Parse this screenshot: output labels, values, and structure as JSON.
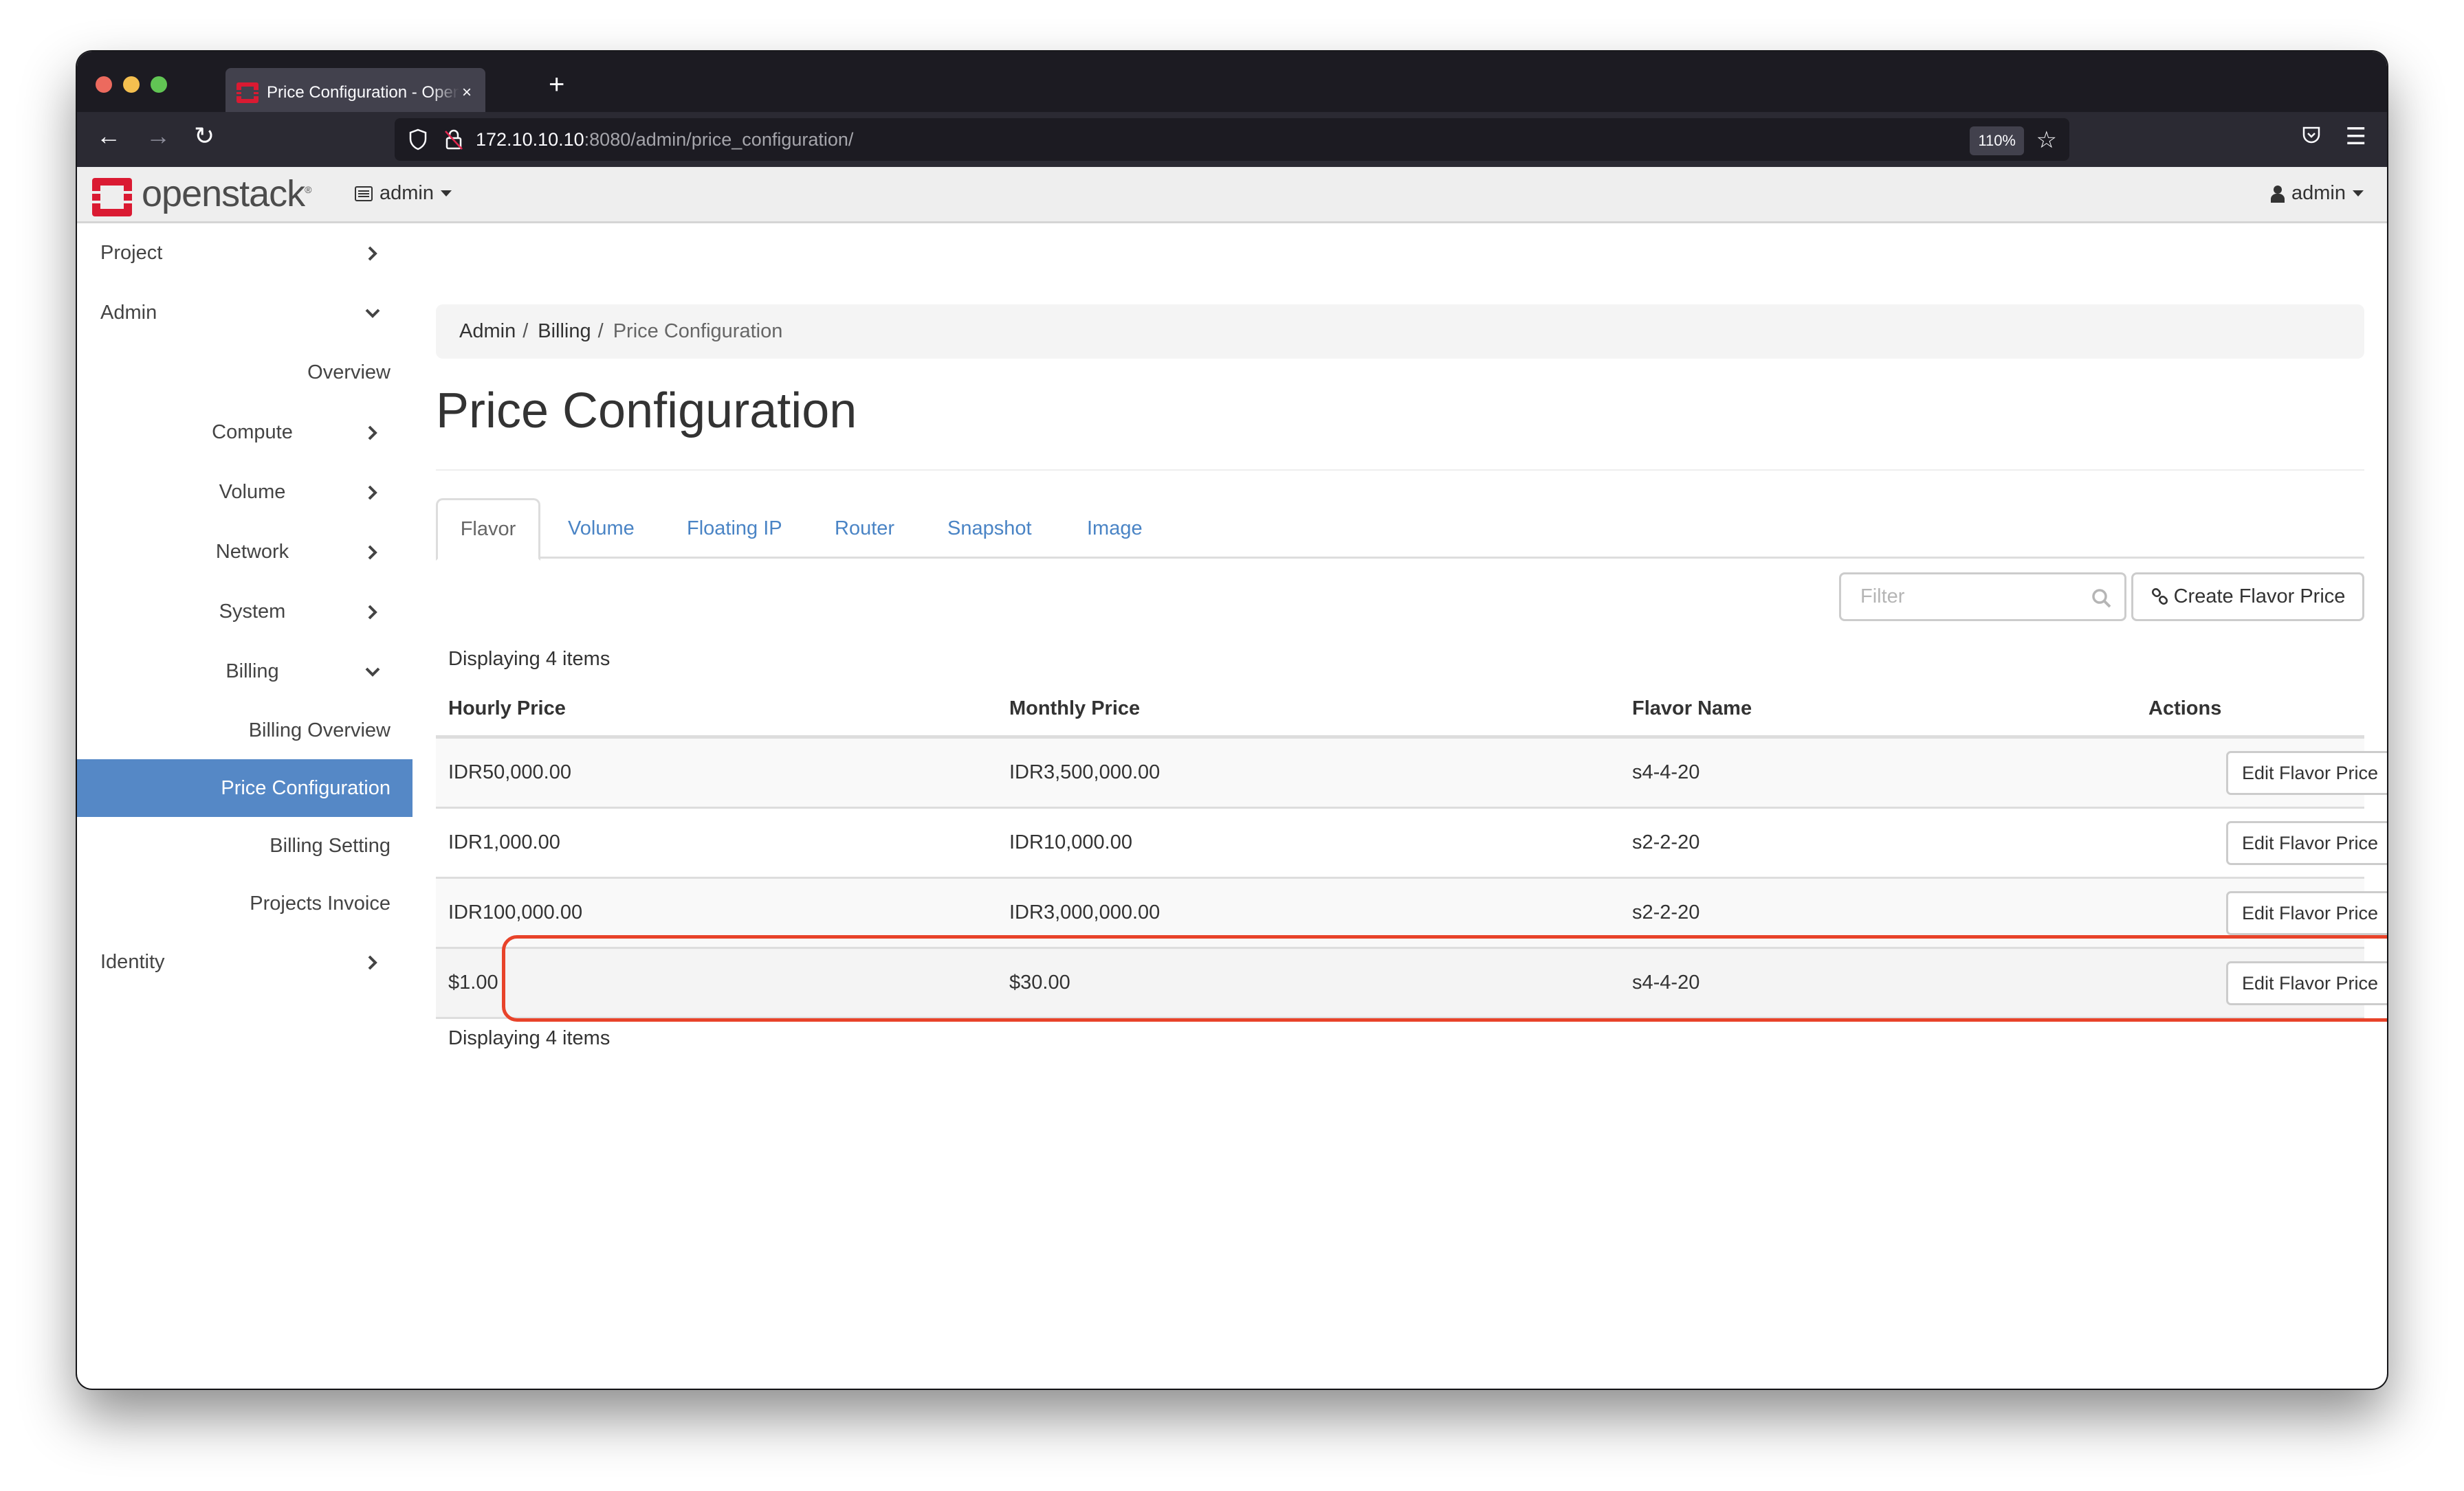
{
  "browser": {
    "tab_title": "Price Configuration - OpenStack",
    "close_glyph": "×",
    "new_tab_glyph": "+",
    "url_host": "172.10.10.10",
    "url_rest": ":8080/admin/price_configuration/",
    "zoom_level": "110%",
    "back_glyph": "←",
    "forward_glyph": "→",
    "reload_glyph": "↻",
    "star_glyph": "☆",
    "menu_glyph": "☰"
  },
  "header": {
    "logo_text": "openstack",
    "logo_mark": "®",
    "project_selector": "admin",
    "user_menu": "admin",
    "brand_color": "#da1a32"
  },
  "sidebar": {
    "items": [
      {
        "label": "Project",
        "level": 1,
        "icon": "chevron-right-icon"
      },
      {
        "label": "Admin",
        "level": 1,
        "icon": "chevron-down-icon"
      },
      {
        "label": "Overview",
        "level": 2
      },
      {
        "label": "Compute",
        "level": 2,
        "icon": "chevron-right-icon"
      },
      {
        "label": "Volume",
        "level": 2,
        "icon": "chevron-right-icon"
      },
      {
        "label": "Network",
        "level": 2,
        "icon": "chevron-right-icon"
      },
      {
        "label": "System",
        "level": 2,
        "icon": "chevron-right-icon"
      },
      {
        "label": "Billing",
        "level": 2,
        "icon": "chevron-down-icon"
      },
      {
        "label": "Billing Overview",
        "level": 3
      },
      {
        "label": "Price Configuration",
        "level": 3,
        "active": true
      },
      {
        "label": "Billing Setting",
        "level": 3
      },
      {
        "label": "Projects Invoice",
        "level": 3
      },
      {
        "label": "Identity",
        "level": 1,
        "icon": "chevron-right-icon"
      }
    ],
    "active_color": "#5588c6"
  },
  "breadcrumb": {
    "items": [
      "Admin",
      "Billing"
    ],
    "separator": "/",
    "current": "Price Configuration"
  },
  "page": {
    "title": "Price Configuration"
  },
  "tabs": [
    {
      "label": "Flavor",
      "active": true
    },
    {
      "label": "Volume"
    },
    {
      "label": "Floating IP"
    },
    {
      "label": "Router"
    },
    {
      "label": "Snapshot"
    },
    {
      "label": "Image"
    }
  ],
  "toolbar": {
    "filter_placeholder": "Filter",
    "filter_value": "",
    "create_label": "Create Flavor Price"
  },
  "table": {
    "count_top": "Displaying 4 items",
    "count_bottom": "Displaying 4 items",
    "columns": [
      "Hourly Price",
      "Monthly Price",
      "Flavor Name",
      "Actions"
    ],
    "rows": [
      {
        "hourly": "IDR50,000.00",
        "monthly": "IDR3,500,000.00",
        "flavor": "s4-4-20",
        "action": "Edit Flavor Price"
      },
      {
        "hourly": "IDR1,000.00",
        "monthly": "IDR10,000.00",
        "flavor": "s2-2-20",
        "action": "Edit Flavor Price"
      },
      {
        "hourly": "IDR100,000.00",
        "monthly": "IDR3,000,000.00",
        "flavor": "s2-2-20",
        "action": "Edit Flavor Price"
      },
      {
        "hourly": "$1.00",
        "monthly": "$30.00",
        "flavor": "s4-4-20",
        "action": "Edit Flavor Price",
        "highlighted": true
      }
    ]
  },
  "annotation": {
    "highlight_color": "#e8432a"
  }
}
